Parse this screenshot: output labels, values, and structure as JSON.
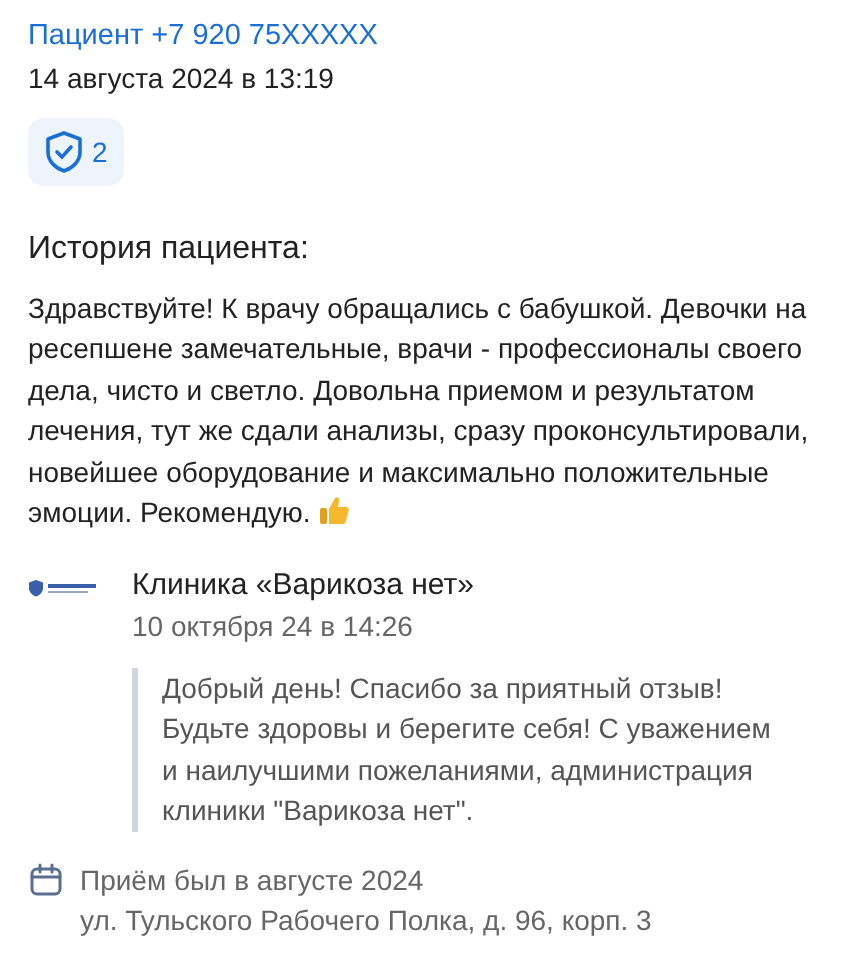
{
  "author": "Пациент +7 920 75XXXXX",
  "date": "14 августа 2024 в 13:19",
  "badge": {
    "count": "2"
  },
  "story": {
    "title": "История пациента:",
    "text": "Здравствуйте! К врачу обращались с бабушкой. Девочки на ресепшене замечательные, врачи - профессионалы своего дела, чисто и светло. Довольна приемом и результатом лечения, тут же сдали анализы, сразу проконсультировали, новейшее оборудование и максимально положительные эмоции. Рекомендую."
  },
  "reply": {
    "clinic": "Клиника «Варикоза нет»",
    "date": "10 октября 24 в 14:26",
    "text": "Добрый день! Спасибо за приятный отзыв! Будьте здоровы и берегите себя! С уважением и наилучшими пожеланиями, администрация клиники \"Варикоза нет\"."
  },
  "visit": {
    "when": "Приём был в августе 2024",
    "address": "ул. Тульского Рабочего Полка, д. 96, корп. 3"
  }
}
